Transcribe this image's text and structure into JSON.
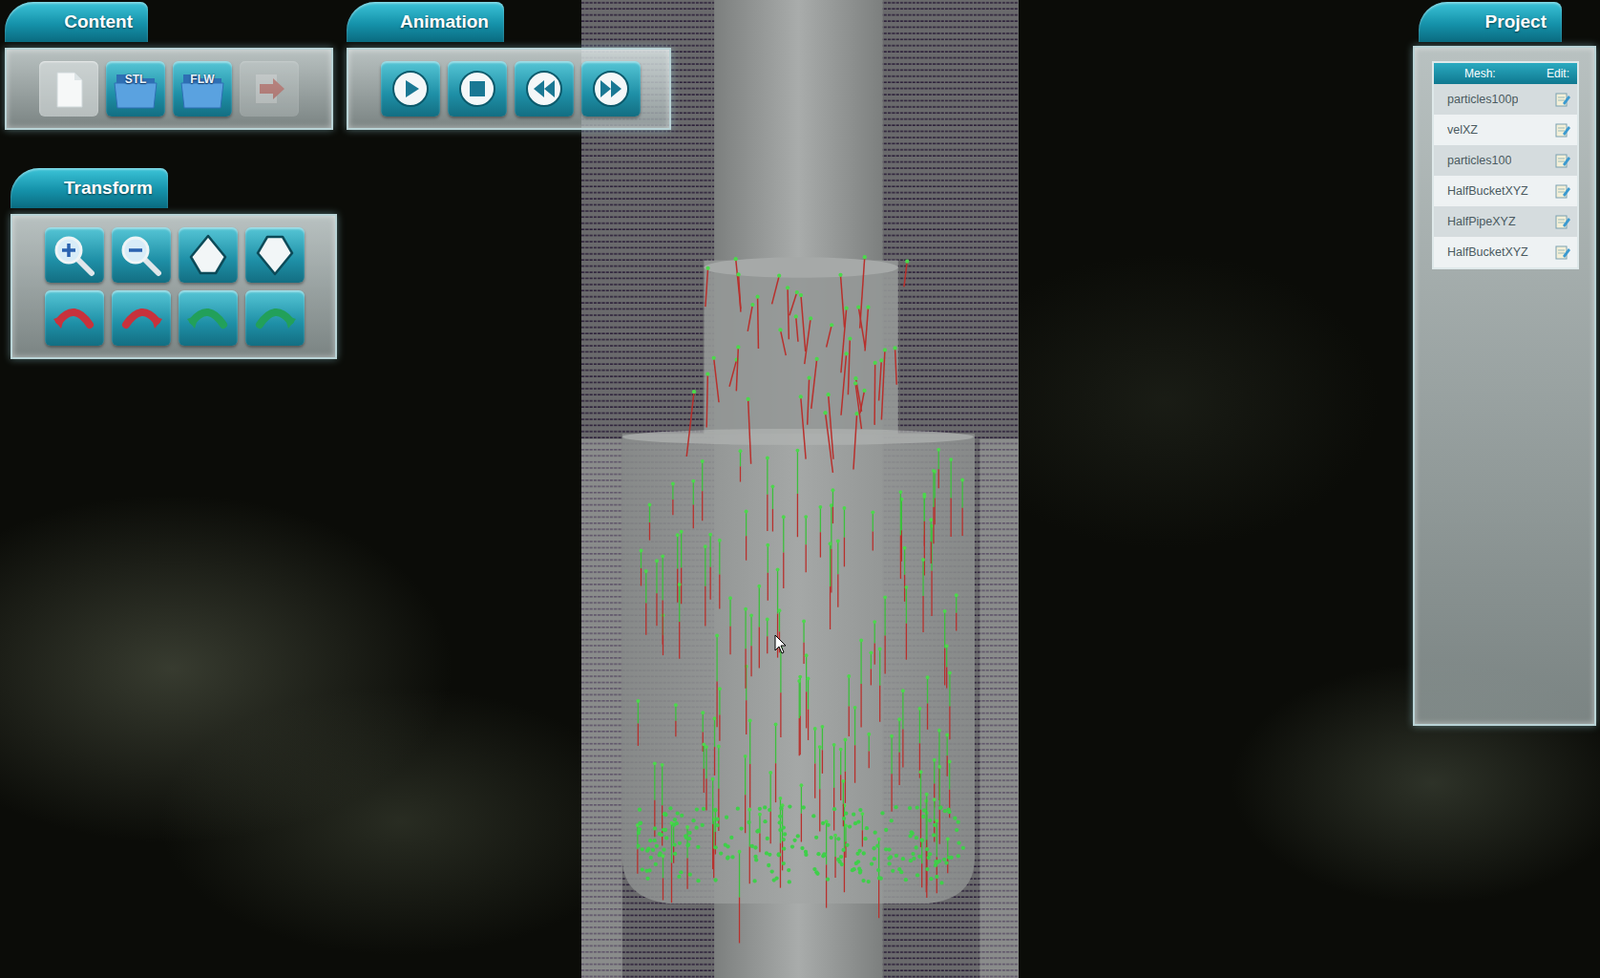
{
  "panels": {
    "content": {
      "title": "Content",
      "buttons": [
        {
          "kind": "new",
          "disabled": false
        },
        {
          "kind": "folder",
          "label": "STL",
          "disabled": false
        },
        {
          "kind": "folder",
          "label": "FLW",
          "disabled": false
        },
        {
          "kind": "export",
          "disabled": true
        }
      ]
    },
    "animation": {
      "title": "Animation",
      "buttons": [
        {
          "kind": "play"
        },
        {
          "kind": "stop"
        },
        {
          "kind": "rewind"
        },
        {
          "kind": "forward"
        }
      ]
    },
    "transform": {
      "title": "Transform",
      "buttons": [
        {
          "kind": "zoom-in"
        },
        {
          "kind": "zoom-out"
        },
        {
          "kind": "up"
        },
        {
          "kind": "down"
        },
        {
          "kind": "rotate-ccw",
          "color": "#c8323c"
        },
        {
          "kind": "rotate-cw",
          "color": "#c8323c"
        },
        {
          "kind": "rotate-ccw",
          "color": "#22a05a"
        },
        {
          "kind": "rotate-cw",
          "color": "#22a05a"
        }
      ]
    },
    "project": {
      "title": "Project",
      "columns": [
        "Mesh:",
        "Edit:"
      ],
      "meshes": [
        {
          "name": "particles100p"
        },
        {
          "name": "velXZ"
        },
        {
          "name": "particles100"
        },
        {
          "name": "HalfBucketXYZ"
        },
        {
          "name": "HalfPipeXYZ"
        },
        {
          "name": "HalfBucketXYZ"
        }
      ]
    }
  }
}
